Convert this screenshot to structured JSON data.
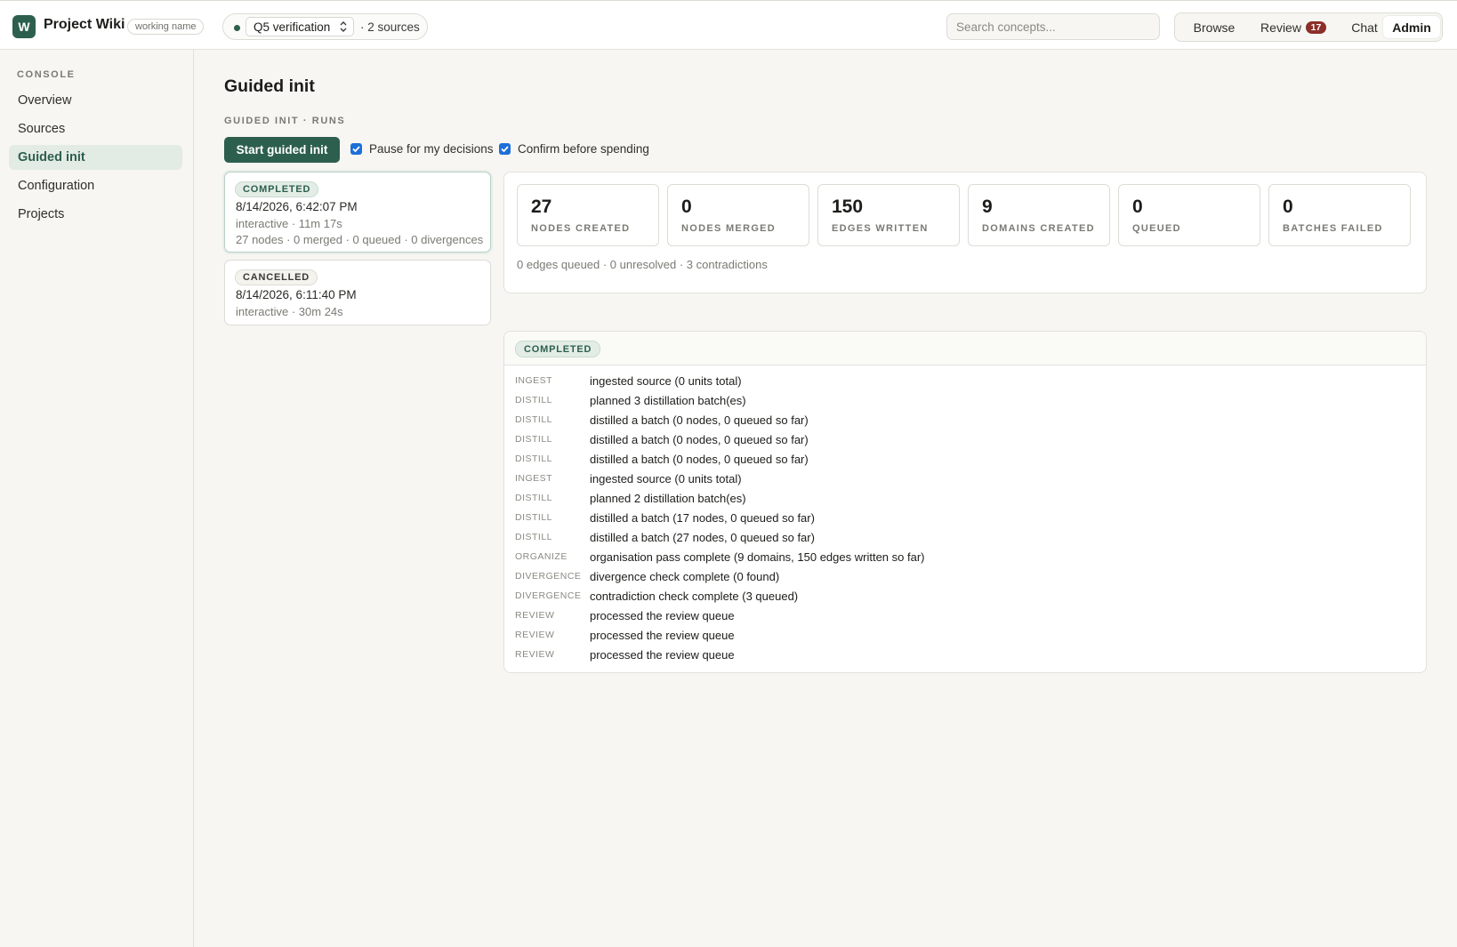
{
  "app": {
    "logo_letter": "W",
    "title": "Project Wiki",
    "tag": "working name"
  },
  "project": {
    "selected": "Q5 verification",
    "sources_text": "· 2 sources"
  },
  "search": {
    "placeholder": "Search concepts..."
  },
  "nav": {
    "browse": "Browse",
    "review": "Review",
    "review_count": "17",
    "chat": "Chat",
    "admin": "Admin"
  },
  "sidebar": {
    "heading": "CONSOLE",
    "items": [
      {
        "label": "Overview"
      },
      {
        "label": "Sources"
      },
      {
        "label": "Guided init"
      },
      {
        "label": "Configuration"
      },
      {
        "label": "Projects"
      }
    ]
  },
  "page": {
    "title": "Guided init",
    "section_label": "GUIDED INIT · RUNS",
    "start_button": "Start guided init",
    "option_pause": "Pause for my decisions",
    "option_confirm": "Confirm before spending"
  },
  "runs": [
    {
      "status": "COMPLETED",
      "date": "8/14/2026, 6:42:07 PM",
      "mode": "interactive · 11m 17s",
      "summary": "27 nodes · 0 merged · 0 queued · 0 divergences"
    },
    {
      "status": "CANCELLED",
      "date": "8/14/2026, 6:11:40 PM",
      "mode": "interactive · 30m 24s"
    }
  ],
  "stats": {
    "cards": [
      {
        "value": "27",
        "label": "NODES CREATED"
      },
      {
        "value": "0",
        "label": "NODES MERGED"
      },
      {
        "value": "150",
        "label": "EDGES WRITTEN"
      },
      {
        "value": "9",
        "label": "DOMAINS CREATED"
      },
      {
        "value": "0",
        "label": "QUEUED"
      },
      {
        "value": "0",
        "label": "BATCHES FAILED"
      }
    ],
    "footer": "0 edges queued · 0 unresolved · 3 contradictions"
  },
  "log": {
    "status": "COMPLETED",
    "entries": [
      {
        "stage": "INGEST",
        "text": "ingested source (0 units total)"
      },
      {
        "stage": "DISTILL",
        "text": "planned 3 distillation batch(es)"
      },
      {
        "stage": "DISTILL",
        "text": "distilled a batch (0 nodes, 0 queued so far)"
      },
      {
        "stage": "DISTILL",
        "text": "distilled a batch (0 nodes, 0 queued so far)"
      },
      {
        "stage": "DISTILL",
        "text": "distilled a batch (0 nodes, 0 queued so far)"
      },
      {
        "stage": "INGEST",
        "text": "ingested source (0 units total)"
      },
      {
        "stage": "DISTILL",
        "text": "planned 2 distillation batch(es)"
      },
      {
        "stage": "DISTILL",
        "text": "distilled a batch (17 nodes, 0 queued so far)"
      },
      {
        "stage": "DISTILL",
        "text": "distilled a batch (27 nodes, 0 queued so far)"
      },
      {
        "stage": "ORGANIZE",
        "text": "organisation pass complete (9 domains, 150 edges written so far)"
      },
      {
        "stage": "DIVERGENCE",
        "text": "divergence check complete (0 found)"
      },
      {
        "stage": "DIVERGENCE",
        "text": "contradiction check complete (3 queued)"
      },
      {
        "stage": "REVIEW",
        "text": "processed the review queue"
      },
      {
        "stage": "REVIEW",
        "text": "processed the review queue"
      },
      {
        "stage": "REVIEW",
        "text": "processed the review queue"
      }
    ]
  },
  "colors": {
    "brand": "#2d5f4e",
    "badge": "#8c2f2a",
    "checkbox": "#1e6fd9"
  }
}
